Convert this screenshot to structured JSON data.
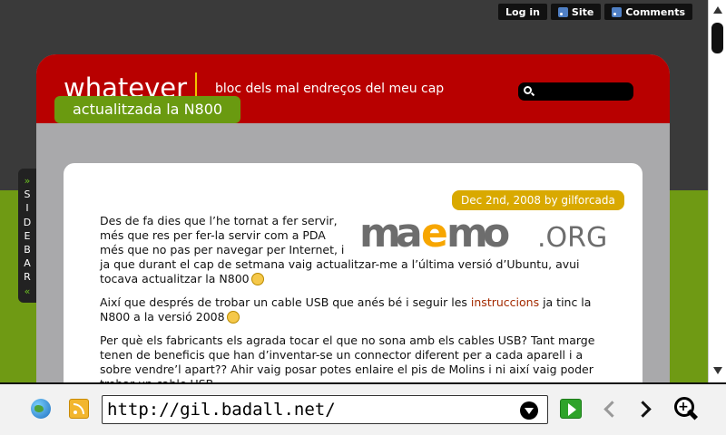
{
  "top_links": {
    "login": "Log in",
    "site": "Site",
    "comments": "Comments"
  },
  "header": {
    "site_title": "whatever",
    "tagline": "bloc dels mal endreços del meu cap",
    "search_placeholder": ""
  },
  "post": {
    "title": "actualitzada la N800",
    "date_author": "Dec 2nd, 2008 by gilforcada",
    "paragraph1": "Des de fa dies que l’he tornat a fer servir, més que res per fer-la servir com a PDA més que no pas per navegar per Internet, i ja que durant el cap de setmana vaig actualitzar-me a l’última versió d’Ubuntu, avui tocava actualitzar la N800",
    "paragraph2_before": "Així que després de trobar un cable USB que anés bé i seguir les",
    "paragraph2_link": "instruccions",
    "paragraph2_after": "ja tinc la N800 a la versió 2008",
    "paragraph3": "Per què els fabricants els agrada tocar el que no sona amb els cables USB? Tant marge tenen de beneficis que han d’inventar-se un connector diferent per a cada aparell i a sobre vendre’l apart?? Ahir vaig posar potes enlaire el pis de Molins i ni així vaig poder trobar un cable USB",
    "image_logo_text_a": "maemo",
    "image_logo_text_b": ".ORG"
  },
  "sidebar_tab": {
    "label_top_arrow": "»",
    "label": "SIDEBAR",
    "label_bottom_arrow": "«"
  },
  "browser": {
    "url": "http://gil.badall.net/"
  },
  "colors": {
    "header_red": "#b80000",
    "accent_green": "#6a9a10",
    "date_gold": "#d9a900",
    "link": "#a32a00"
  },
  "icons": [
    "rss-icon",
    "search-icon",
    "globe-icon",
    "feed-icon",
    "dropdown-icon",
    "go-icon",
    "back-icon",
    "forward-icon",
    "zoom-icon",
    "smiley-icon"
  ]
}
